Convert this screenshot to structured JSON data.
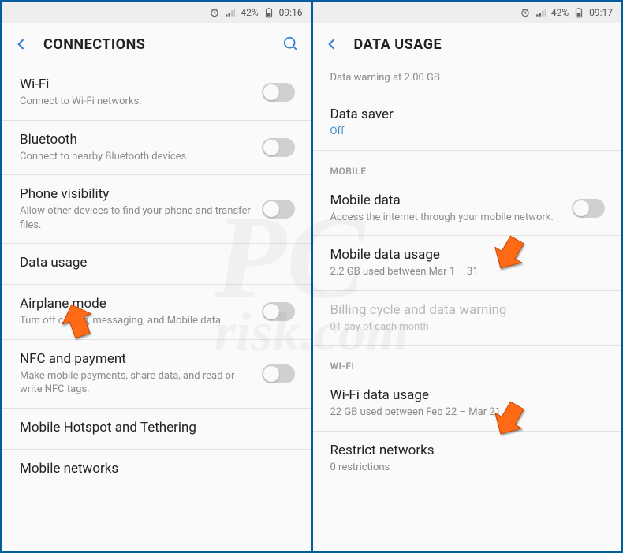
{
  "statusbar": {
    "battery": "42%",
    "time_left": "09:16",
    "time_right": "09:17"
  },
  "left": {
    "title": "CONNECTIONS",
    "items": [
      {
        "title": "Wi-Fi",
        "sub": "Connect to Wi-Fi networks.",
        "toggle": true
      },
      {
        "title": "Bluetooth",
        "sub": "Connect to nearby Bluetooth devices.",
        "toggle": true
      },
      {
        "title": "Phone visibility",
        "sub": "Allow other devices to find your phone and transfer files.",
        "toggle": true
      },
      {
        "title": "Data usage",
        "sub": "",
        "toggle": false
      },
      {
        "title": "Airplane mode",
        "sub": "Turn off calling, messaging, and Mobile data.",
        "toggle": true
      },
      {
        "title": "NFC and payment",
        "sub": "Make mobile payments, share data, and read or write NFC tags.",
        "toggle": true
      },
      {
        "title": "Mobile Hotspot and Tethering",
        "sub": "",
        "toggle": false
      },
      {
        "title": "Mobile networks",
        "sub": "",
        "toggle": false
      }
    ]
  },
  "right": {
    "title": "DATA USAGE",
    "warning": "Data warning at 2.00 GB",
    "data_saver": {
      "title": "Data saver",
      "value": "Off"
    },
    "section_mobile": "MOBILE",
    "mobile_data": {
      "title": "Mobile data",
      "sub": "Access the internet through your mobile network."
    },
    "mobile_usage": {
      "title": "Mobile data usage",
      "sub": "2.2 GB used between Mar 1 – 31"
    },
    "billing": {
      "title": "Billing cycle and data warning",
      "sub": "01 day of each month"
    },
    "section_wifi": "WI-FI",
    "wifi_usage": {
      "title": "Wi-Fi data usage",
      "sub": "22 GB used between Feb 22 – Mar 21"
    },
    "restrict": {
      "title": "Restrict networks",
      "sub": "0 restrictions"
    }
  }
}
